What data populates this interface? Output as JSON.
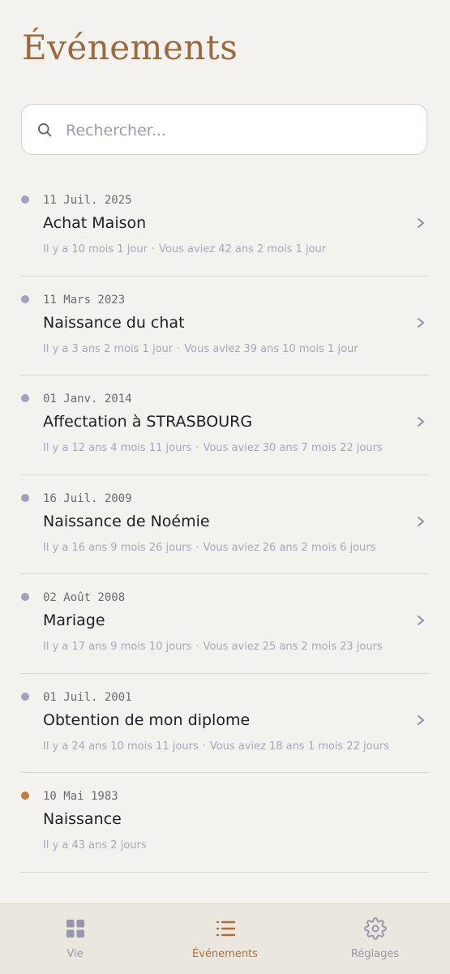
{
  "header": {
    "title": "Événements"
  },
  "search": {
    "placeholder": "Rechercher..."
  },
  "events": [
    {
      "date": "11 Juil. 2025",
      "name": "Achat Maison",
      "ago": "Il y a 10 mois 1 jour",
      "age": "Vous aviez 42 ans 2 mois 1 jour"
    },
    {
      "date": "11 Mars 2023",
      "name": "Naissance du chat",
      "ago": "Il y a 3 ans 2 mois 1 jour",
      "age": "Vous aviez 39 ans 10 mois 1 jour"
    },
    {
      "date": "01 Janv. 2014",
      "name": "Affectation à STRASBOURG",
      "ago": "Il y a 12 ans 4 mois 11 jours",
      "age": "Vous aviez 30 ans 7 mois 22 jours"
    },
    {
      "date": "16 Juil. 2009",
      "name": "Naissance de Noémie",
      "ago": "Il y a 16 ans 9 mois 26 jours",
      "age": "Vous aviez 26 ans 2 mois 6 jours"
    },
    {
      "date": "02 Août 2008",
      "name": "Mariage",
      "ago": "Il y a 17 ans 9 mois 10 jours",
      "age": "Vous aviez 25 ans 2 mois 23 jours"
    },
    {
      "date": "01 Juil. 2001",
      "name": "Obtention de mon diplome",
      "ago": "Il y a 24 ans 10 mois 11 jours",
      "age": "Vous aviez 18 ans 1 mois 22 jours"
    },
    {
      "date": "10 Mai 1983",
      "name": "Naissance",
      "ago": "Il y a 43 ans 2 jours",
      "age": ""
    }
  ],
  "tabs": [
    {
      "label": "Vie",
      "icon": "grid-icon"
    },
    {
      "label": "Événements",
      "icon": "list-icon"
    },
    {
      "label": "Réglages",
      "icon": "gear-icon"
    }
  ],
  "colors": {
    "accent": "#b06e3c",
    "title": "#9a6a3c",
    "dot": "#a3a0bd",
    "origin_dot": "#c27a3e",
    "inactive_tab": "#9896ae"
  }
}
